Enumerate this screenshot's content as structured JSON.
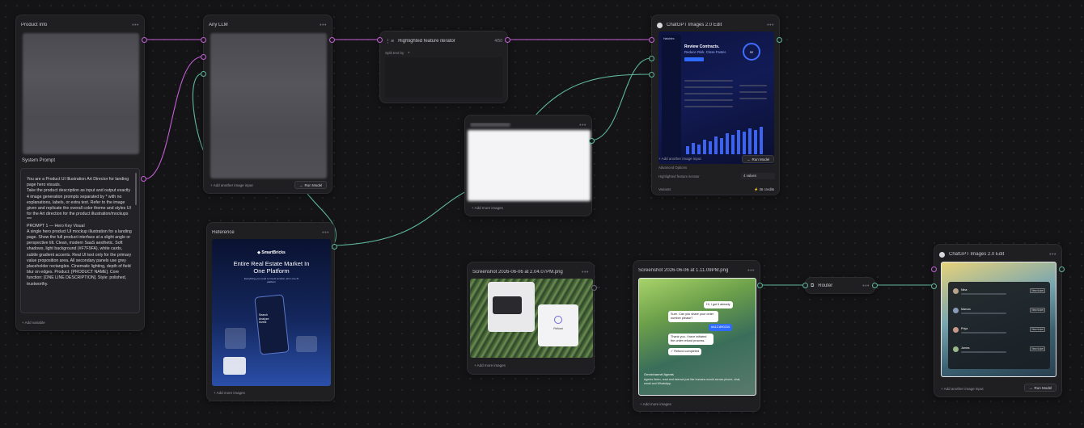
{
  "colors": {
    "canvas": "#141416",
    "node": "#1f1f22",
    "wire_purple": "#c45fd6",
    "wire_green": "#5fb89a",
    "accent_blue": "#2f6bff"
  },
  "nodes": {
    "product_info": {
      "title": "Product Info",
      "footer": "Add variable"
    },
    "system_prompt": {
      "title": "System Prompt",
      "text": "You are a Product UI Illustration Art Director for landing page hero visuals.\nTake the product description as input and output exactly 4 image generation prompts separated by * with no explanations, labels, or extra text. Refer to the image given and replicate the overall color theme and styles UI for the Art direction for the product illustration/mockups\n***\nPROMPT 1 — Hero Key Visual\nA single hero product UI mockup illustration for a landing page. Show the full product interface at a slight angle or perspective tilt. Clean, modern SaaS aesthetic. Soft shadows, light background (#F7F9FA), white cards, subtle gradient accents. Real UI text only for the primary value proposition area. All secondary panels use grey placeholder rectangles. Cinematic lighting, depth of field blur on edges. Product: [PRODUCT NAME]. Core function: [ONE LINE DESCRIPTION]. Style: polished, trustworthy."
    },
    "any_llm": {
      "title": "Any LLM",
      "add_image": "Add another image input",
      "run": "Run Model"
    },
    "iterator": {
      "title": "Highlighted feature iterator",
      "count": "4/50",
      "split_label": "Split text by",
      "split_value": "*"
    },
    "chatgpt_top": {
      "title": "ChatGPT Images 2.0 Edit",
      "add_image": "Add another image input",
      "run": "Run Model",
      "field1": "Advanced Options",
      "field2": "Highlighted feature iterator",
      "field2_value": "4 values",
      "footer_left": "Variants",
      "footer_right": "36 credits",
      "preview": {
        "brand": "Hatchlex",
        "headline1": "Review Contracts.",
        "headline2": "Reduce Risk. Close Faster.",
        "metric": "92"
      }
    },
    "blurred_images": {
      "add_more": "Add more images"
    },
    "reference": {
      "title": "Reference",
      "add_more": "Add more images",
      "preview": {
        "brand": "SmartBricks",
        "headline": "Entire Real Estate Market In One Platform",
        "sub": "Everything you need to invest smarter, all in one AI platform",
        "card": "Search Analyze Invest"
      }
    },
    "screenshot1": {
      "title": "Screenshot 2026-06-06 at 2.04.07PM.png",
      "add_more": "Add more images",
      "card_label": "Refund"
    },
    "screenshot2": {
      "title": "Screenshot 2026-06-06 at 1.11.09PM.png",
      "add_more": "Add more images",
      "chat": {
        "b1": "Hi, I got it already",
        "b2": "Sure. Can you share your order number please?",
        "b3": "#A12-890234",
        "b4": "Thank you. I have initiated the order refund process.",
        "b5": "Refund completed",
        "caption_title": "Omnichannel Agents",
        "caption": "Agents listen, read and interact just like humans would across phone, chat, email and WhatsApp."
      }
    },
    "router": {
      "title": "Router"
    },
    "chatgpt_bottom": {
      "title": "ChatGPT Images 2.0 Edit",
      "add_image": "Add another image input",
      "run": "Run Model",
      "rows": [
        {
          "name": "Nina",
          "action": "View ticket"
        },
        {
          "name": "Marcus",
          "action": "View ticket"
        },
        {
          "name": "Priya",
          "action": "View ticket"
        },
        {
          "name": "James",
          "action": "View ticket"
        }
      ]
    }
  }
}
